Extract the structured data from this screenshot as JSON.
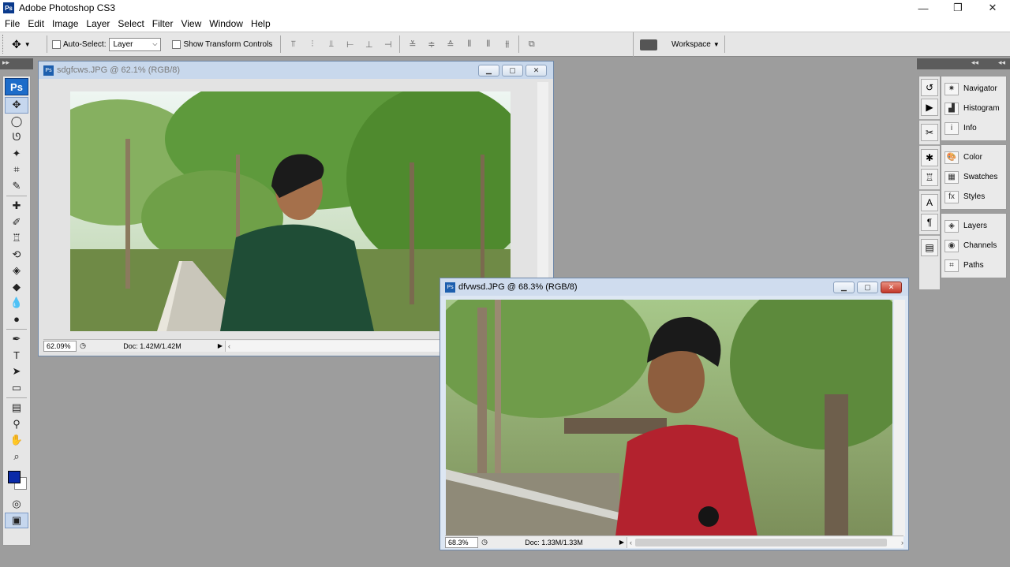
{
  "app": {
    "title": "Adobe Photoshop CS3",
    "logo_text": "Ps",
    "window_controls": {
      "minimize": "—",
      "restore": "❐",
      "close": "✕"
    }
  },
  "menu": [
    "File",
    "Edit",
    "Image",
    "Layer",
    "Select",
    "Filter",
    "View",
    "Window",
    "Help"
  ],
  "options": {
    "auto_select_label": "Auto-Select:",
    "auto_select_value": "Layer",
    "transform_label": "Show Transform Controls",
    "workspace_label": "Workspace"
  },
  "tools": {
    "badge": "Ps",
    "items": [
      {
        "name": "move-tool",
        "glyph": "✥"
      },
      {
        "name": "marquee-tool",
        "glyph": "◯"
      },
      {
        "name": "lasso-tool",
        "glyph": "ᘎ"
      },
      {
        "name": "magic-wand-tool",
        "glyph": "✦"
      },
      {
        "name": "crop-tool",
        "glyph": "⌗"
      },
      {
        "name": "slice-tool",
        "glyph": "✎"
      },
      {
        "name": "healing-brush-tool",
        "glyph": "✚"
      },
      {
        "name": "brush-tool",
        "glyph": "✐"
      },
      {
        "name": "clone-stamp-tool",
        "glyph": "♖"
      },
      {
        "name": "history-brush-tool",
        "glyph": "⟲"
      },
      {
        "name": "eraser-tool",
        "glyph": "◈"
      },
      {
        "name": "paint-bucket-tool",
        "glyph": "◆"
      },
      {
        "name": "blur-tool",
        "glyph": "💧"
      },
      {
        "name": "dodge-tool",
        "glyph": "●"
      },
      {
        "name": "pen-tool",
        "glyph": "✒"
      },
      {
        "name": "type-tool",
        "glyph": "T"
      },
      {
        "name": "path-selection-tool",
        "glyph": "➤"
      },
      {
        "name": "shape-tool",
        "glyph": "▭"
      },
      {
        "name": "notes-tool",
        "glyph": "▤"
      },
      {
        "name": "eyedropper-tool",
        "glyph": "⚲"
      },
      {
        "name": "hand-tool",
        "glyph": "✋"
      },
      {
        "name": "zoom-tool",
        "glyph": "⌕"
      }
    ],
    "bottom": {
      "quick_mask": "◎",
      "screen_mode": "▣"
    }
  },
  "documents": [
    {
      "title": "sdgfcws.JPG @ 62.1% (RGB/8)",
      "zoom": "62.09%",
      "doc_size": "Doc: 1.42M/1.42M"
    },
    {
      "title": "dfvwsd.JPG @ 68.3% (RGB/8)",
      "zoom": "68.3%",
      "doc_size": "Doc: 1.33M/1.33M"
    }
  ],
  "panels": {
    "group1": [
      "Navigator",
      "Histogram",
      "Info"
    ],
    "group2": [
      "Color",
      "Swatches",
      "Styles"
    ],
    "group3": [
      "Layers",
      "Channels",
      "Paths"
    ]
  },
  "colors": {
    "foreground": "#0a2aa8",
    "background": "#ffffff",
    "app_bg": "#9d9d9d"
  }
}
